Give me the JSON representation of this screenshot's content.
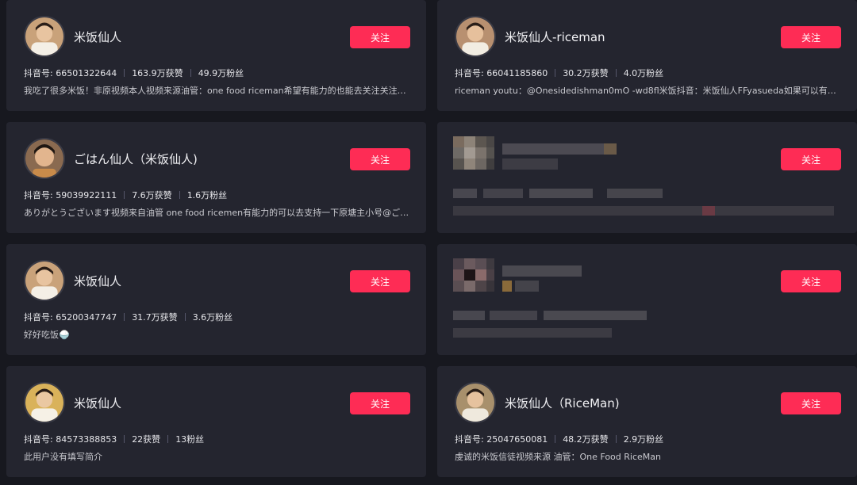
{
  "follow_label": "关注",
  "colors": {
    "accent": "#fe2c55",
    "card": "#24252f",
    "page": "#17181f"
  },
  "users": [
    {
      "name": "米饭仙人",
      "douyin_id": "抖音号: 66501322644",
      "likes": "163.9万获赞",
      "fans": "49.9万粉丝",
      "bio": "我吃了很多米饭！非原视频本人视频来源油管：one food riceman希望有能力的也能去关注关注原..."
    },
    {
      "name": "米饭仙人-riceman",
      "douyin_id": "抖音号: 66041185860",
      "likes": "30.2万获赞",
      "fans": "4.0万粉丝",
      "bio": "riceman youtu：@Onesidedishman0mO -wd8fl米饭抖音：米饭仙人FFyasueda如果可以有一..."
    },
    {
      "name": "ごはん仙人（米饭仙人)",
      "douyin_id": "抖音号: 59039922111",
      "likes": "7.6万获赞",
      "fans": "1.6万粉丝",
      "bio": "ありがとうございます视频来自油管 one food ricemen有能力的可以去支持一下原塘主小号@ごは..."
    },
    {
      "blurred": true
    },
    {
      "name": "米饭仙人",
      "douyin_id": "抖音号: 65200347747",
      "likes": "31.7万获赞",
      "fans": "3.6万粉丝",
      "bio": "好好吃饭🍚"
    },
    {
      "blurred": true
    },
    {
      "name": "米饭仙人",
      "douyin_id": "抖音号: 84573388853",
      "likes": "22获赞",
      "fans": "13粉丝",
      "bio": "此用户没有填写简介"
    },
    {
      "name": "米饭仙人（RiceMan)",
      "douyin_id": "抖音号: 25047650081",
      "likes": "48.2万获赞",
      "fans": "2.9万粉丝",
      "bio": "虔诚的米饭信徒视频来源 油管：One Food RiceMan"
    }
  ]
}
